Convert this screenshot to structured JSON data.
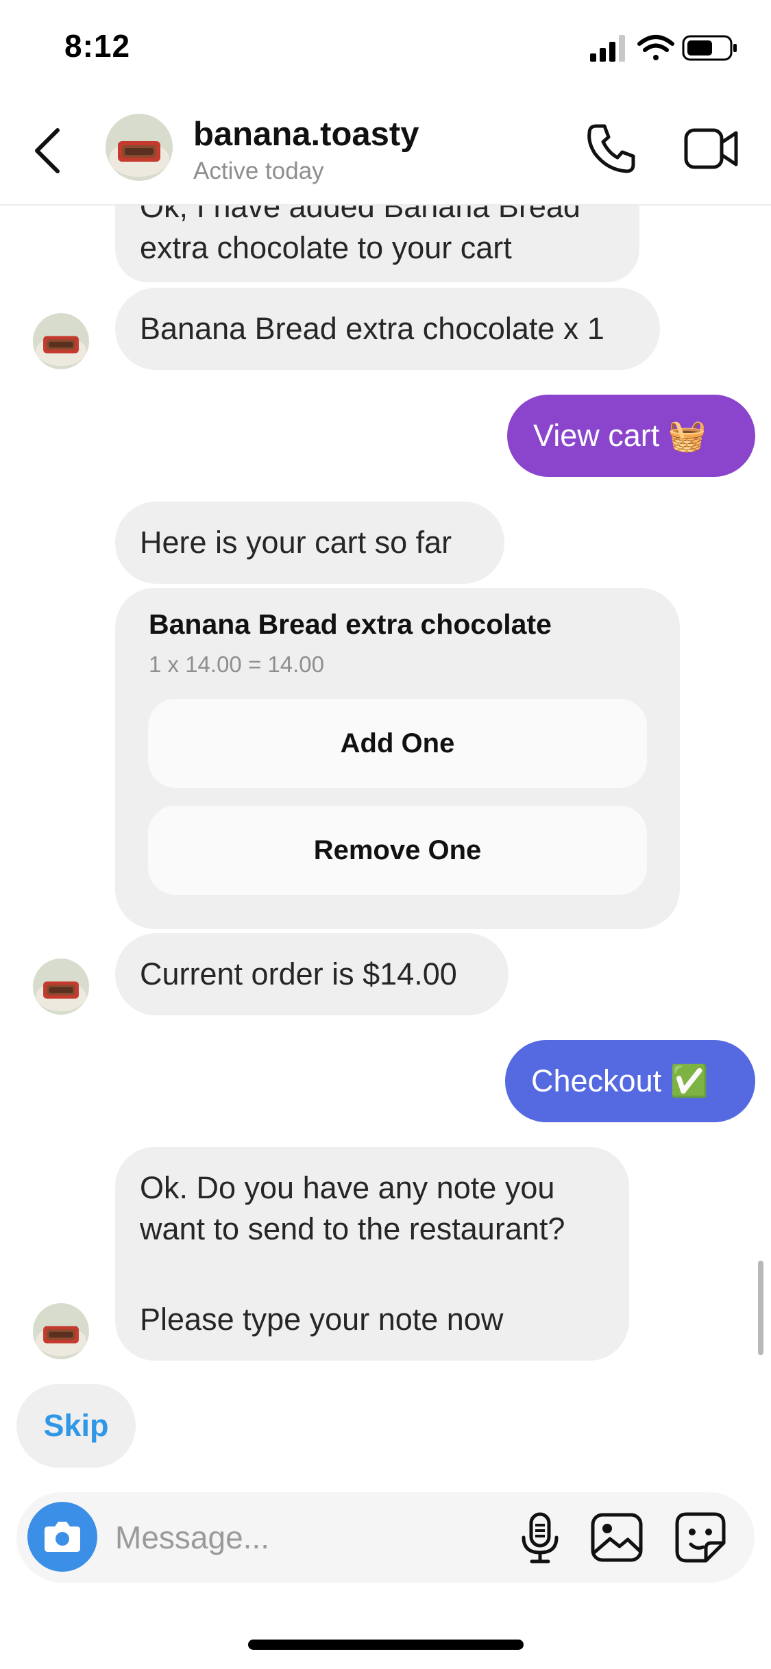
{
  "status_bar": {
    "time": "8:12",
    "icons": [
      "signal-icon",
      "wifi-icon",
      "battery-icon"
    ]
  },
  "header": {
    "name": "banana.toasty",
    "status": "Active today",
    "icons": [
      "back-arrow-icon",
      "phone-icon",
      "video-camera-icon"
    ]
  },
  "messages": {
    "added_line1": "Ok, I have added Banana Bread",
    "added_line2": "extra chocolate to your cart",
    "added_item": "Banana Bread extra chocolate x 1",
    "view_cart": "View cart 🧺",
    "cart_intro": "Here is your cart so far",
    "current_order": "Current order is $14.00",
    "checkout": "Checkout ✅",
    "note_line1": "Ok. Do you have any note you",
    "note_line2": "want to send to the restaurant?",
    "note_line3": "Please type your note now"
  },
  "cart_card": {
    "item_title": "Banana Bread extra chocolate",
    "item_detail": "1 x 14.00 = 14.00",
    "add_label": "Add One",
    "remove_label": "Remove One"
  },
  "quick_reply": {
    "skip_label": "Skip"
  },
  "composer": {
    "placeholder": "Message...",
    "icons": [
      "camera-icon",
      "microphone-icon",
      "gallery-icon",
      "sticker-icon"
    ]
  },
  "colors": {
    "incoming_bubble": "#efefef",
    "view_cart_bubble": "#8b45cc",
    "checkout_bubble": "#5569e0",
    "skip_text": "#2f97e6",
    "camera_button": "#3b8fe6"
  }
}
